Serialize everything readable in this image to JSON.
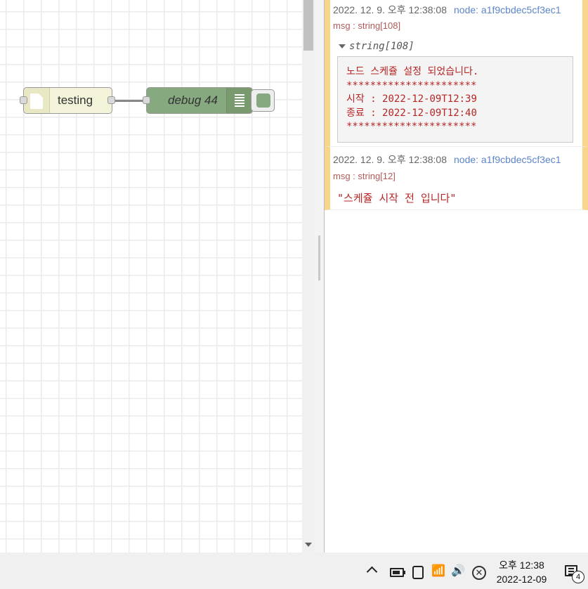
{
  "canvas": {
    "inject_node": {
      "label": "testing",
      "icon": "file-icon"
    },
    "debug_node": {
      "label": "debug 44",
      "icon": "list-icon"
    }
  },
  "debug_panel": {
    "messages": [
      {
        "timestamp": "2022. 12. 9. 오후 12:38:08",
        "node_ref": "node: a1f9cbdec5cf3ec1",
        "msg_type": "msg : string[108]",
        "expand_label": "string[108]",
        "lines": [
          "노드 스케쥴 설정 되었습니다.",
          "**********************",
          "시작 : 2022-12-09T12:39",
          "종료 : 2022-12-09T12:40",
          "**********************"
        ]
      },
      {
        "timestamp": "2022. 12. 9. 오후 12:38:08",
        "node_ref": "node: a1f9cbdec5cf3ec1",
        "msg_type": "msg : string[12]",
        "value": "\"스케쥴 시작 전 입니다\""
      }
    ]
  },
  "taskbar": {
    "time": "오후 12:38",
    "date": "2022-12-09",
    "notification_count": "4",
    "icons": [
      "chevron-up-icon",
      "battery-icon",
      "meet-now-icon",
      "wifi-icon",
      "speaker-icon",
      "error-icon",
      "notification-icon"
    ]
  },
  "colors": {
    "debug_node": "#87a980",
    "inject_node": "#f3f3d9",
    "message_border": "#f8d58a",
    "string_text": "#b72525",
    "node_link": "#5d85c9"
  }
}
